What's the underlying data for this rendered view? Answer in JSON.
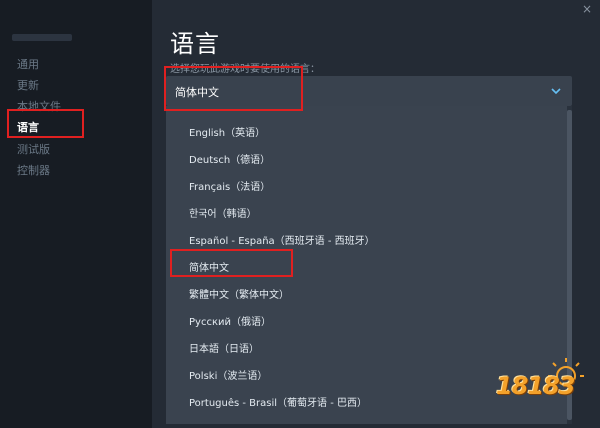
{
  "window": {
    "close_label": "×"
  },
  "sidebar": {
    "items": [
      {
        "label": "通用",
        "active": false
      },
      {
        "label": "更新",
        "active": false
      },
      {
        "label": "本地文件",
        "active": false
      },
      {
        "label": "语言",
        "active": true
      },
      {
        "label": "测试版",
        "active": false
      },
      {
        "label": "控制器",
        "active": false
      }
    ]
  },
  "main": {
    "title": "语言",
    "subtitle": "选择您玩此游戏时要使用的语言：",
    "language_select": {
      "selected": "简体中文",
      "icon": "chevron-down-icon",
      "options": [
        "English（英语）",
        "Deutsch（德语）",
        "Français（法语）",
        "한국어（韩语）",
        "Español - España（西班牙语 - 西班牙）",
        "简体中文",
        "繁體中文（繁体中文）",
        "Русский（俄语）",
        "日本語（日语）",
        "Polski（波兰语）",
        "Português - Brasil（葡萄牙语 - 巴西）"
      ]
    }
  },
  "watermark": {
    "text": "18183"
  },
  "colors": {
    "highlight": "#e02020",
    "accent": "#66c0f4",
    "sidebar_bg": "#171c23",
    "main_bg": "#242b35",
    "dropdown_bg": "#3a434f"
  }
}
